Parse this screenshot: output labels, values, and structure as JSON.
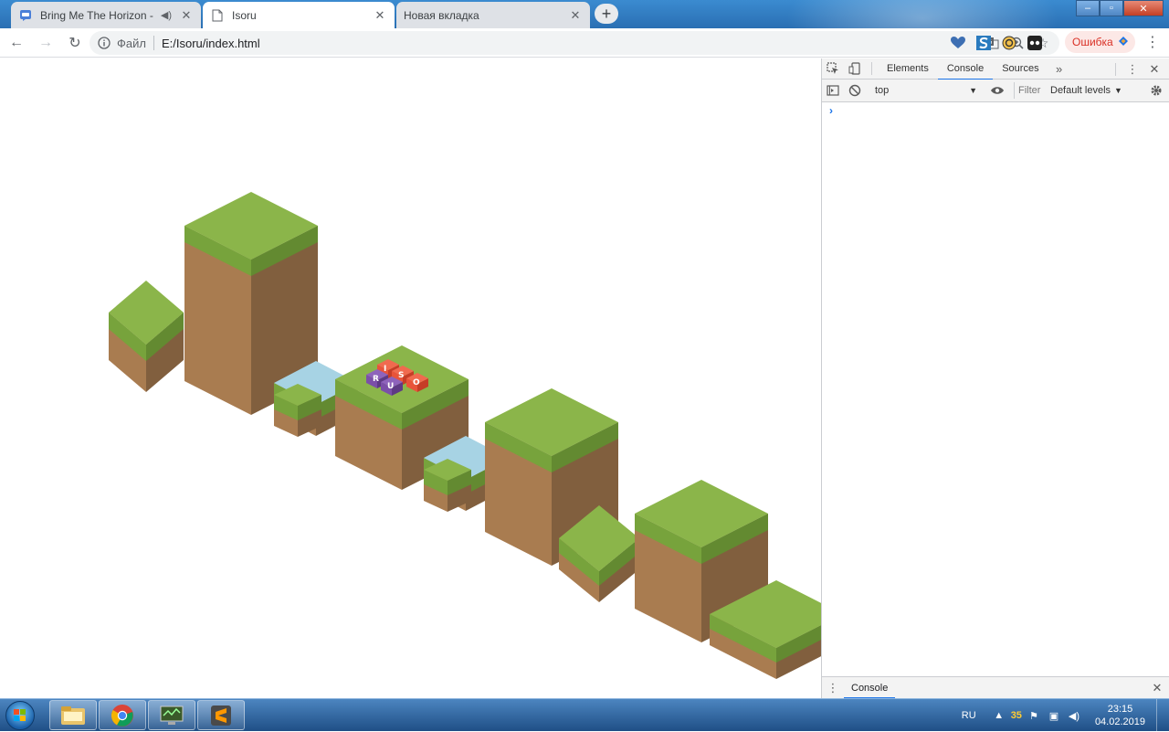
{
  "browser": {
    "tabs": [
      {
        "title": "Bring Me The Horizon - i apo",
        "audio_icon": "speaker-icon",
        "close": "✕",
        "active": false
      },
      {
        "title": "Isoru",
        "close": "✕",
        "active": true
      },
      {
        "title": "Новая вкладка",
        "close": "✕",
        "active": false
      }
    ],
    "new_tab": "+",
    "window_controls": {
      "minimize": "‒",
      "maximize": "▫",
      "close": "✕"
    }
  },
  "toolbar": {
    "back": "←",
    "forward": "→",
    "reload": "↻",
    "scheme_label": "Файл",
    "url": "E:/Isoru/index.html",
    "error_label": "Ошибка",
    "menu": "⋮"
  },
  "page": {
    "logo_letters": [
      "I",
      "S",
      "O",
      "R",
      "U"
    ]
  },
  "devtools": {
    "tabs": [
      "Elements",
      "Console",
      "Sources"
    ],
    "active_tab": "Console",
    "more": "»",
    "menu": "⋮",
    "close": "✕",
    "context": "top",
    "filter_placeholder": "Filter",
    "levels": "Default levels",
    "prompt": "›",
    "drawer_tab": "Console"
  },
  "taskbar": {
    "language": "RU",
    "tray_badge": "35",
    "time": "23:15",
    "date": "04.02.2019"
  },
  "colors": {
    "grass_top": "#8bb54a",
    "grass_left": "#77a33c",
    "grass_right": "#638a31",
    "dirt_left": "#a97c50",
    "dirt_right": "#815f3e",
    "water": "#a7d3e4",
    "accent": "#1a73e8"
  }
}
